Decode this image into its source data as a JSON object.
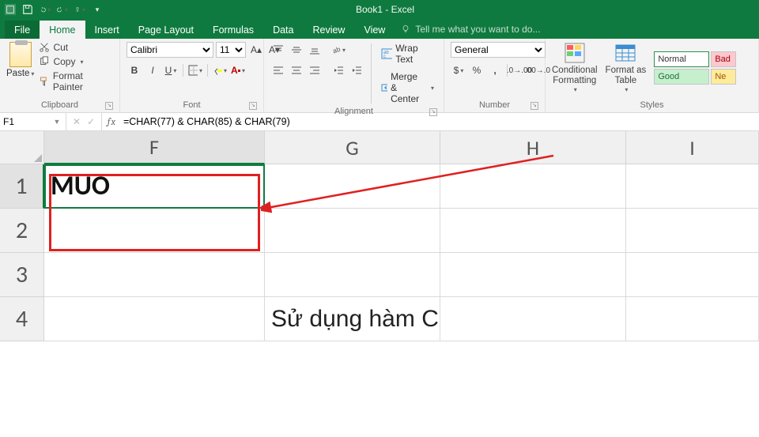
{
  "title": "Book1 - Excel",
  "qat": {
    "save": "save-icon",
    "undo": "undo-icon",
    "redo": "redo-icon",
    "touch": "touch-icon"
  },
  "tabs": {
    "file": "File",
    "home": "Home",
    "insert": "Insert",
    "page_layout": "Page Layout",
    "formulas": "Formulas",
    "data": "Data",
    "review": "Review",
    "view": "View",
    "tell_me": "Tell me what you want to do..."
  },
  "ribbon": {
    "clipboard": {
      "label": "Clipboard",
      "paste": "Paste",
      "cut": "Cut",
      "copy": "Copy",
      "format_painter": "Format Painter"
    },
    "font": {
      "label": "Font",
      "name": "Calibri",
      "size": "11"
    },
    "alignment": {
      "label": "Alignment",
      "wrap": "Wrap Text",
      "merge": "Merge & Center"
    },
    "number": {
      "label": "Number",
      "format": "General"
    },
    "cond": "Conditional\nFormatting",
    "fmt_table": "Format as\nTable",
    "styles": {
      "label": "Styles",
      "normal": "Normal",
      "bad": "Bad",
      "good": "Good",
      "neutral": "Ne"
    }
  },
  "namebox": "F1",
  "formula": "=CHAR(77) & CHAR(85) & CHAR(79)",
  "cols": {
    "F": "F",
    "G": "G",
    "H": "H",
    "I": "I"
  },
  "rows": {
    "r1": "1",
    "r2": "2",
    "r3": "3",
    "r4": "4"
  },
  "cells": {
    "F1": "MUO",
    "G4_text": "Sử dụng hàm CHAR trong Excel"
  }
}
